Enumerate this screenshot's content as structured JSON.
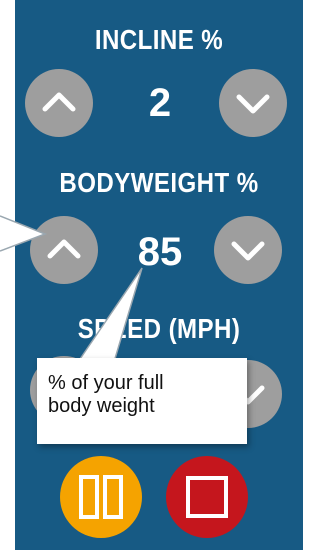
{
  "incline": {
    "label": "INCLINE %",
    "value": "2"
  },
  "bodyweight": {
    "label": "BODYWEIGHT %",
    "value": "85"
  },
  "speed": {
    "label": "SPEED (MPH)"
  },
  "tooltip": {
    "text": "% of your full body weight"
  },
  "icons": {
    "up": "chevron-up-icon",
    "down": "chevron-down-icon",
    "pause": "pause-icon",
    "stop": "stop-icon"
  },
  "colors": {
    "panel": "#175a84",
    "button": "#9e9e9e",
    "pause": "#f5a300",
    "stop": "#c5161d",
    "text": "#ffffff"
  }
}
